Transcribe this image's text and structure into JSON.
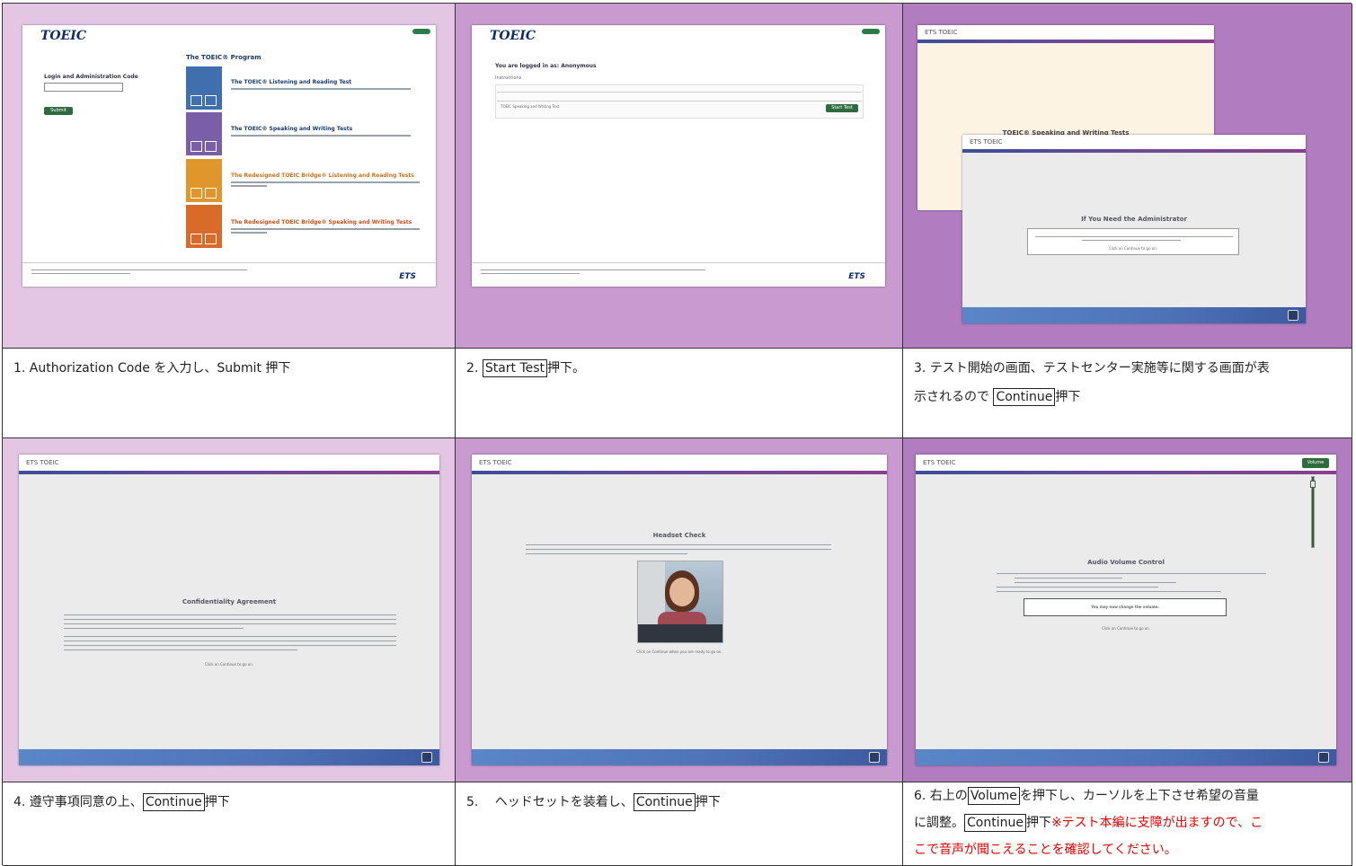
{
  "captions": {
    "step1": "1. Authorization Code を入力し、Submit 押下",
    "step2_prefix": "2.",
    "step2_button": "Start Test",
    "step2_suffix": "押下。",
    "step3_line1": "3. テスト開始の画面、テストセンター実施等に関する画面が表",
    "step3_line2_prefix": "示されるので",
    "step3_button": "Continue",
    "step3_suffix": "押下",
    "step4_prefix": "4. 遵守事項同意の上、",
    "step4_button": "Continue",
    "step4_suffix": "押下",
    "step5_prefix": "5.　 ヘッドセットを装着し、",
    "step5_button": "Continue",
    "step5_suffix": "押下",
    "step6_prefix": "6. 右上の",
    "step6_button1": "Volume",
    "step6_mid": "を押下し、カーソルを上下させ希望の音量",
    "step6_line2_prefix": "に調整。",
    "step6_button2": "Continue",
    "step6_line2_suffix": "押下",
    "step6_warning1": "※テスト本編に支障が出ますので、こ",
    "step6_warning2": "こで音声が聞こえることを確認してください。"
  },
  "screens": {
    "s1": {
      "logo": "TOEIC",
      "login_label": "Login and Administration Code",
      "submit": "Submit",
      "program_title": "The TOEIC® Program",
      "programs": [
        {
          "title": "The TOEIC® Listening and Reading Test",
          "color": "#3f6fae"
        },
        {
          "title": "The TOEIC® Speaking and Writing Tests",
          "color": "#7a5fa8"
        },
        {
          "title": "The Redesigned TOEIC Bridge® Listening and Reading Tests",
          "color": "#e0962a"
        },
        {
          "title": "The Redesigned TOEIC Bridge® Speaking and Writing Tests",
          "color": "#d96a2a"
        }
      ],
      "ets": "ETS"
    },
    "s2": {
      "logo": "TOEIC",
      "logged_in": "You are logged in as: Anonymous",
      "section": "Instructions",
      "row_label": "TOEIC Speaking and Writing Test",
      "start": "Start Test",
      "ets": "ETS"
    },
    "s3": {
      "title": "TOEIC® Speaking and Writing Tests",
      "modal_title": "If You Need the Administrator",
      "continue_note": "Click on Continue to go on."
    },
    "s4": {
      "title": "Confidentiality Agreement",
      "continue_note": "Click on Continue to go on."
    },
    "s5": {
      "title": "Headset Check",
      "continue_note": "Click on Continue when you are ready to go on."
    },
    "s6": {
      "title": "Audio Volume Control",
      "box_text": "You may now change the volume.",
      "continue_note": "Click on Continue to go on.",
      "volume": "Volume"
    }
  }
}
